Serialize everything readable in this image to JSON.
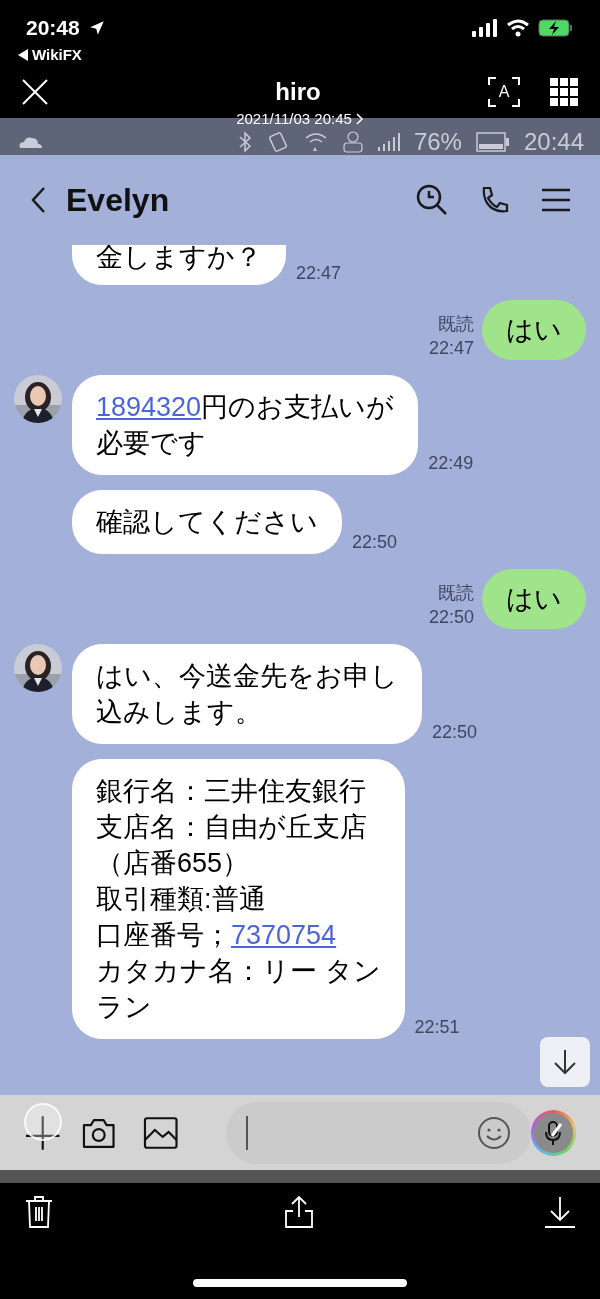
{
  "status_bar": {
    "time": "20:48",
    "back_app": "WikiFX"
  },
  "viewer": {
    "title": "hiro",
    "date": "2021/11/03 20:45",
    "scan_label": "A"
  },
  "screenshot": {
    "status": {
      "battery": "76%",
      "time": "20:44"
    },
    "chat": {
      "contact": "Evelyn",
      "messages": [
        {
          "kind": "incoming",
          "avatar": false,
          "lines": [
            [
              {
                "text": "金しますか？"
              }
            ]
          ],
          "time": "22:47"
        },
        {
          "kind": "outgoing",
          "read": "既読",
          "lines": [
            [
              {
                "text": "はい"
              }
            ]
          ],
          "time": "22:47"
        },
        {
          "kind": "incoming",
          "avatar": true,
          "lines": [
            [
              {
                "text": "1894320",
                "link": true
              },
              {
                "text": "円のお支払いが"
              }
            ],
            [
              {
                "text": "必要です"
              }
            ]
          ],
          "time": "22:49"
        },
        {
          "kind": "incoming",
          "avatar": false,
          "lines": [
            [
              {
                "text": "確認してください"
              }
            ]
          ],
          "time": "22:50"
        },
        {
          "kind": "outgoing",
          "read": "既読",
          "lines": [
            [
              {
                "text": "はい"
              }
            ]
          ],
          "time": "22:50"
        },
        {
          "kind": "incoming",
          "avatar": true,
          "lines": [
            [
              {
                "text": "はい、今送金先をお申し"
              }
            ],
            [
              {
                "text": "込みします。"
              }
            ]
          ],
          "time": "22:50"
        },
        {
          "kind": "incoming",
          "avatar": false,
          "lines": [
            [
              {
                "text": "銀行名：三井住友銀行"
              }
            ],
            [
              {
                "text": "支店名：自由が丘支店"
              }
            ],
            [
              {
                "text": "（店番655）"
              }
            ],
            [
              {
                "text": "取引種類:普通"
              }
            ],
            [
              {
                "text": "口座番号；"
              },
              {
                "text": "7370754",
                "link": true
              }
            ],
            [
              {
                "text": "カタカナ名：リー タン"
              }
            ],
            [
              {
                "text": "ラン"
              }
            ]
          ],
          "time": "22:51"
        }
      ]
    }
  }
}
